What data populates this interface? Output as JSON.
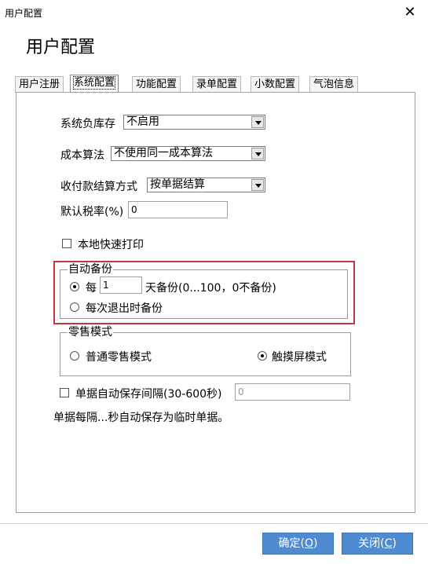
{
  "window": {
    "title": "用户配置",
    "close_glyph": "✕"
  },
  "header": {
    "title": "用户配置"
  },
  "tabs": [
    {
      "label": "用户注册",
      "active": false
    },
    {
      "label": "系统配置",
      "active": true
    },
    {
      "label": "功能配置",
      "active": false
    },
    {
      "label": "录单配置",
      "active": false
    },
    {
      "label": "小数配置",
      "active": false
    },
    {
      "label": "气泡信息",
      "active": false
    }
  ],
  "system": {
    "negative_stock": {
      "label": "系统负库存",
      "value": "不启用"
    },
    "cost_algorithm": {
      "label": "成本算法",
      "value": "不使用同一成本算法"
    },
    "payment_method": {
      "label": "收付款结算方式",
      "value": "按单据结算"
    },
    "tax_rate": {
      "label": "默认税率(%)",
      "value": "0"
    },
    "local_print": {
      "label": "本地快速打印",
      "checked": false
    },
    "auto_backup": {
      "title": "自动备份",
      "every_prefix": "每",
      "days_value": "1",
      "every_suffix": "天备份(0...100，0不备份)",
      "on_exit_label": "每次退出时备份",
      "selected": "every"
    },
    "retail_mode": {
      "title": "零售模式",
      "normal_label": "普通零售模式",
      "touch_label": "触摸屏模式",
      "selected": "touch"
    },
    "autosave": {
      "label": "单据自动保存间隔(30-600秒)",
      "value": "0",
      "checked": false
    },
    "autosave_note": "单据每隔...秒自动保存为临时单据。"
  },
  "footer": {
    "ok": {
      "text": "确定(",
      "key": "O",
      "close": ")"
    },
    "close": {
      "text": "关闭(",
      "key": "C",
      "close": ")"
    }
  },
  "colors": {
    "button_bg": "#4f8bd1",
    "highlight_border": "#c0383e"
  }
}
